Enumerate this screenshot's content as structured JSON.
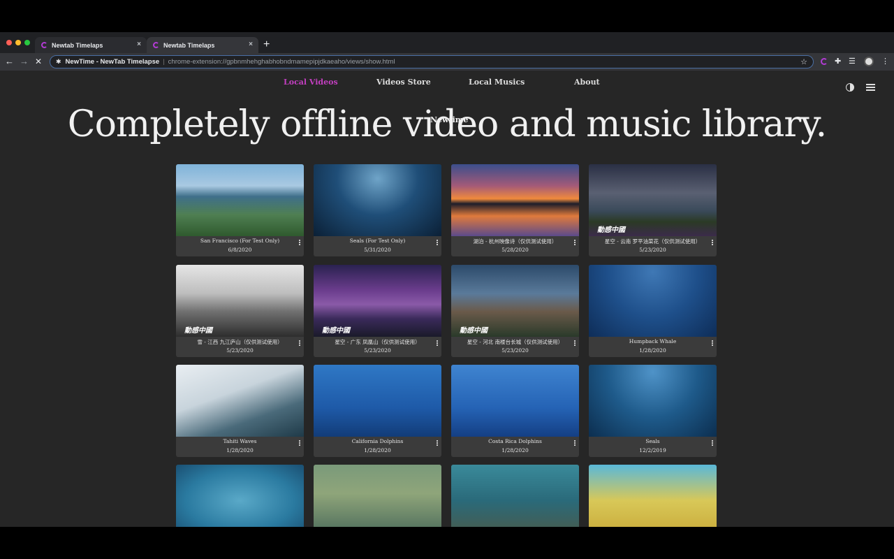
{
  "browser": {
    "tabs": [
      {
        "label": "Newtab Timelaps",
        "close": "×"
      },
      {
        "label": "Newtab Timelaps",
        "close": "×"
      }
    ],
    "new_tab": "+",
    "back": "←",
    "forward": "→",
    "stop": "✕",
    "omnibox": {
      "page_title": "NewTime - NewTab Timelapse",
      "separator": "|",
      "url": "chrome-extension://gpbnmhehghabhobndmamepipjdkaeaho/views/show.html",
      "star": "☆"
    }
  },
  "nav": {
    "items": [
      {
        "label": "Local Videos",
        "active": true
      },
      {
        "label": "Videos Store",
        "active": false
      },
      {
        "label": "Local Musics",
        "active": false
      },
      {
        "label": "About",
        "active": false
      }
    ]
  },
  "hero": {
    "headline": "Completely offline video and music library.",
    "logo_word": "Newtime"
  },
  "videos": [
    {
      "title": "San Francisco (For Test Only)",
      "date": "6/8/2020",
      "thumb": "linear-gradient(180deg,#7fb3d9 0%,#a9c9e2 30%,#3f6f8a 45%,#4f7f52 70%,#2f5a2e 100%)",
      "watermark": ""
    },
    {
      "title": "Seals (For Test Only)",
      "date": "5/31/2020",
      "thumb": "radial-gradient(ellipse at 50% 20%,#6fa4c8 0%,#1f4e78 45%,#0b2036 100%)",
      "watermark": ""
    },
    {
      "title": "湖泊 - 杭州映像诗（仅供测试使用）",
      "date": "5/28/2020",
      "thumb": "linear-gradient(180deg,#3b4e8c 0%,#a35a78 30%,#f08a3c 48%,#1d1d2a 55%,#e07a3c 72%,#5b4a8c 100%)",
      "watermark": ""
    },
    {
      "title": "星空 - 云南 罗平油菜花（仅供测试使用）",
      "date": "5/23/2020",
      "thumb": "linear-gradient(180deg,#2a2f44 0%,#5a6072 40%,#3a4a5a 65%,#2b3a25 80%,#3b2b4a 100%)",
      "watermark": "動感中國"
    },
    {
      "title": "雪 - 江西 九江庐山（仅供测试使用）",
      "date": "5/23/2020",
      "thumb": "linear-gradient(180deg,#e6e6e6 0%,#bdbdbd 40%,#707070 65%,#2d2d2d 100%)",
      "watermark": "動感中國"
    },
    {
      "title": "星空 - 广东 凤凰山（仅供测试使用）",
      "date": "5/23/2020",
      "thumb": "linear-gradient(180deg,#2a2250 0%,#6a3c8c 35%,#8a5aa8 55%,#3a2a5a 75%,#1a1a2a 100%)",
      "watermark": "動感中國"
    },
    {
      "title": "星空 - 河北 南楼台长城（仅供测试使用）",
      "date": "5/23/2020",
      "thumb": "linear-gradient(180deg,#2c4a6a 0%,#5a7a9a 40%,#6a5a4a 65%,#2a3a2a 100%)",
      "watermark": "動感中國"
    },
    {
      "title": "Humpback Whale",
      "date": "1/28/2020",
      "thumb": "radial-gradient(ellipse at 50% 10%,#3f78b5 0%,#1e4f8a 50%,#0e2d58 100%)",
      "watermark": ""
    },
    {
      "title": "Tahiti Waves",
      "date": "1/28/2020",
      "thumb": "linear-gradient(160deg,#e9eef2 0%,#c8d4dc 40%,#4a6a7a 70%,#1f3a48 100%)",
      "watermark": ""
    },
    {
      "title": "California Dolphins",
      "date": "1/28/2020",
      "thumb": "linear-gradient(180deg,#2f78c5 0%,#1e5aa8 60%,#123c78 100%)",
      "watermark": ""
    },
    {
      "title": "Costa Rica Dolphins",
      "date": "1/28/2020",
      "thumb": "linear-gradient(180deg,#3f84d0 0%,#2563b5 60%,#143f84 100%)",
      "watermark": ""
    },
    {
      "title": "Seals",
      "date": "12/2/2019",
      "thumb": "radial-gradient(ellipse at 50% 10%,#4f93c8 0%,#1e5a8a 50%,#0c2e4f 100%)",
      "watermark": ""
    },
    {
      "title": "",
      "date": "",
      "thumb": "radial-gradient(ellipse at 50% 50%,#5aa9c8 0%,#2a7aa0 60%,#1a4f72 100%)",
      "watermark": ""
    },
    {
      "title": "",
      "date": "",
      "thumb": "linear-gradient(180deg,#7a9a7a 0%,#8fa57a 40%,#4a6a5a 100%)",
      "watermark": ""
    },
    {
      "title": "",
      "date": "",
      "thumb": "linear-gradient(180deg,#3a8a9a 0%,#2a6a7a 50%,#4a5a4a 100%)",
      "watermark": ""
    },
    {
      "title": "",
      "date": "",
      "thumb": "linear-gradient(180deg,#5ab8d8 0%,#d8c858 50%,#c8a838 100%)",
      "watermark": ""
    }
  ]
}
